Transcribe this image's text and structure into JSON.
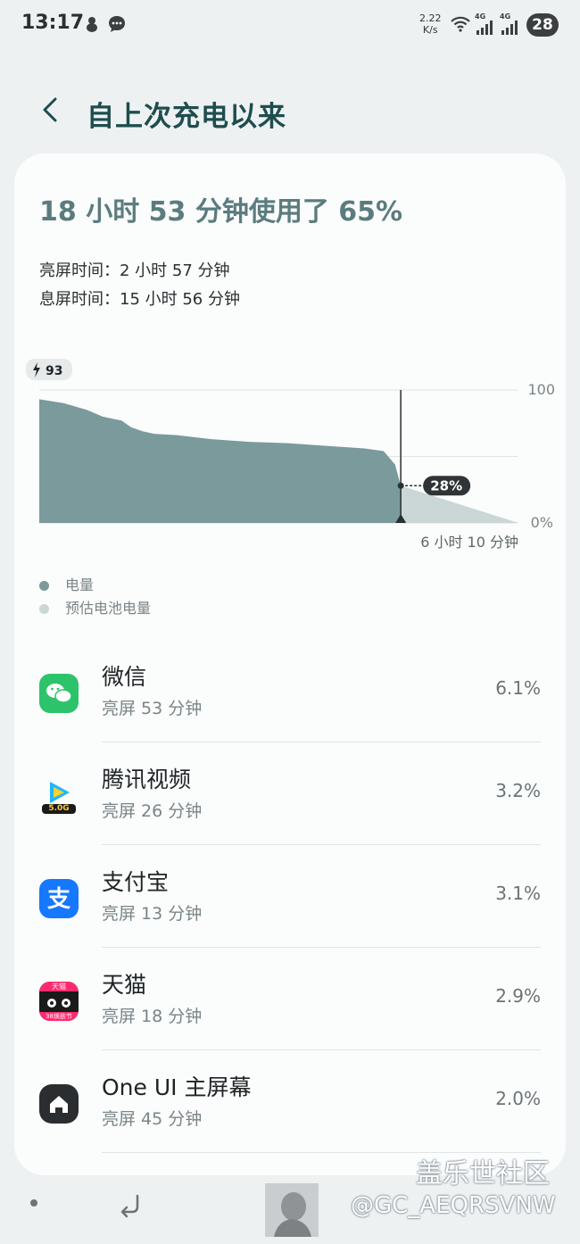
{
  "status_bar": {
    "time": "13:17",
    "net_speed_value": "2.22",
    "net_speed_unit": "K/s",
    "battery_level": "28",
    "signal_labels": [
      "4G",
      "4G"
    ]
  },
  "header": {
    "title": "自上次充电以来"
  },
  "summary": {
    "headline": "18 小时 53 分钟使用了 65%",
    "screen_on": "亮屏时间：2 小时 57 分钟",
    "screen_off": "息屏时间：15 小时 56 分钟"
  },
  "chart_data": {
    "type": "area",
    "start_badge": "93",
    "y_ticks": [
      "100",
      "0%"
    ],
    "ylim": [
      0,
      100
    ],
    "x_hours": [
      0,
      1.3,
      2.5,
      3.3,
      4.3,
      4.8,
      5.4,
      6.0,
      7.2,
      9.0,
      11.0,
      13.0,
      15.0,
      17.0,
      18.0,
      18.6,
      18.9
    ],
    "battery": [
      93,
      90,
      85,
      80,
      77,
      72,
      69,
      67,
      66,
      63,
      61,
      60,
      58,
      56,
      54,
      44,
      28
    ],
    "projected": {
      "x_hours": [
        18.9,
        25.05
      ],
      "battery": [
        28,
        0
      ]
    },
    "current_label": "28%",
    "remaining_label": "6 小时 10 分钟",
    "series": [
      {
        "name": "电量",
        "color": "#7a9a9c"
      },
      {
        "name": "预估电池电量",
        "color": "#cbd6d7"
      }
    ]
  },
  "apps": [
    {
      "name": "微信",
      "screen_time": "亮屏 53 分钟",
      "percent": "6.1%",
      "icon": "wechat-icon",
      "color": "#2dc36a"
    },
    {
      "name": "腾讯视频",
      "screen_time": "亮屏 26 分钟",
      "percent": "3.2%",
      "icon": "tencent-video-icon",
      "color": "#1fb6ff",
      "badge": "5.0G"
    },
    {
      "name": "支付宝",
      "screen_time": "亮屏 13 分钟",
      "percent": "3.1%",
      "icon": "alipay-icon",
      "color": "#1677ff"
    },
    {
      "name": "天猫",
      "screen_time": "亮屏 18 分钟",
      "percent": "2.9%",
      "icon": "tmall-icon",
      "color": "#1a1a1a",
      "badge": "天猫",
      "caption": "38焕肤节"
    },
    {
      "name": "One UI 主屏幕",
      "screen_time": "亮屏 45 分钟",
      "percent": "2.0%",
      "icon": "home-icon",
      "color": "#2b2e30"
    }
  ],
  "watermark": {
    "site": "盖乐世社区",
    "user": "@GC_AEQRSVNW"
  }
}
